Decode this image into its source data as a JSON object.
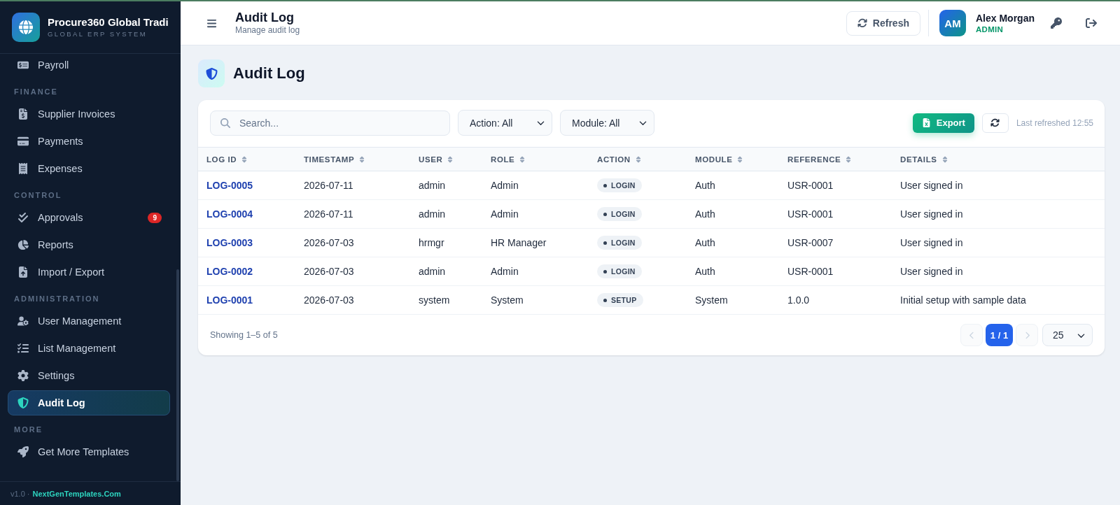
{
  "sidebar": {
    "brand": {
      "title": "Procure360 Global Tradi",
      "subtitle": "GLOBAL ERP SYSTEM"
    },
    "sections": [
      {
        "items": [
          {
            "label": "Payroll",
            "selected": false
          }
        ]
      },
      {
        "label": "FINANCE",
        "items": [
          {
            "label": "Supplier Invoices",
            "selected": false
          },
          {
            "label": "Payments",
            "selected": false
          },
          {
            "label": "Expenses",
            "selected": false
          }
        ]
      },
      {
        "label": "CONTROL",
        "items": [
          {
            "label": "Approvals",
            "selected": false,
            "badge": "9"
          },
          {
            "label": "Reports",
            "selected": false
          },
          {
            "label": "Import / Export",
            "selected": false
          }
        ]
      },
      {
        "label": "ADMINISTRATION",
        "items": [
          {
            "label": "User Management",
            "selected": false
          },
          {
            "label": "List Management",
            "selected": false
          },
          {
            "label": "Settings",
            "selected": false
          },
          {
            "label": "Audit Log",
            "selected": true
          }
        ]
      },
      {
        "label": "MORE",
        "items": [
          {
            "label": "Get More Templates",
            "selected": false
          }
        ]
      }
    ],
    "footer": {
      "version": "v1.0 ·",
      "link": "NextGenTemplates.Com"
    }
  },
  "header": {
    "title": "Audit Log",
    "subtitle": "Manage audit log",
    "refresh_button": "Refresh",
    "user": {
      "initials": "AM",
      "name": "Alex Morgan",
      "role": "ADMIN"
    }
  },
  "page": {
    "title": "Audit Log"
  },
  "toolbar": {
    "search": {
      "placeholder": "Search..."
    },
    "filters": [
      {
        "value": "Action: All"
      },
      {
        "value": "Module: All"
      }
    ],
    "export_button": "Export",
    "last_refreshed": "Last refreshed 12:55"
  },
  "table": {
    "columns": [
      {
        "label": "LOG ID",
        "kind": "link"
      },
      {
        "label": "TIMESTAMP",
        "kind": "text"
      },
      {
        "label": "USER",
        "kind": "text"
      },
      {
        "label": "ROLE",
        "kind": "text"
      },
      {
        "label": "ACTION",
        "kind": "tag"
      },
      {
        "label": "MODULE",
        "kind": "text"
      },
      {
        "label": "REFERENCE",
        "kind": "text"
      },
      {
        "label": "DETAILS",
        "kind": "text"
      }
    ],
    "rows": [
      [
        "LOG-0005",
        "2026-07-11",
        "admin",
        "Admin",
        "LOGIN",
        "Auth",
        "USR-0001",
        "User signed in"
      ],
      [
        "LOG-0004",
        "2026-07-11",
        "admin",
        "Admin",
        "LOGIN",
        "Auth",
        "USR-0001",
        "User signed in"
      ],
      [
        "LOG-0003",
        "2026-07-03",
        "hrmgr",
        "HR Manager",
        "LOGIN",
        "Auth",
        "USR-0007",
        "User signed in"
      ],
      [
        "LOG-0002",
        "2026-07-03",
        "admin",
        "Admin",
        "LOGIN",
        "Auth",
        "USR-0001",
        "User signed in"
      ],
      [
        "LOG-0001",
        "2026-07-03",
        "system",
        "System",
        "SETUP",
        "System",
        "1.0.0",
        "Initial setup with sample data"
      ]
    ]
  },
  "table_footer": {
    "summary": "Showing 1–5 of 5",
    "pagination": {
      "prev_disabled": true,
      "page": "1 / 1",
      "next_disabled": true,
      "page_size": "25"
    }
  }
}
